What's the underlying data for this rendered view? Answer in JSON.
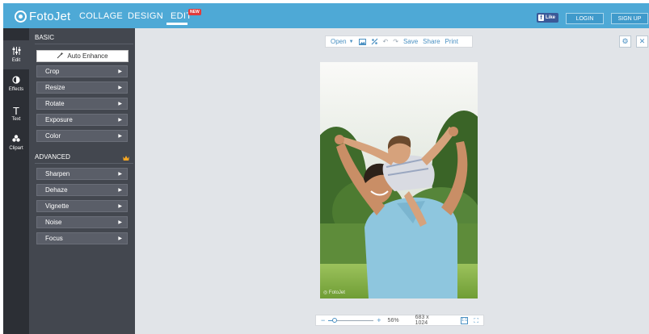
{
  "brand": {
    "name": "FotoJet"
  },
  "nav": {
    "items": [
      {
        "label": "COLLAGE"
      },
      {
        "label": "DESIGN"
      },
      {
        "label": "EDIT"
      }
    ],
    "new_badge": "NEW",
    "active_tab": "EDIT"
  },
  "top_actions": {
    "fb_like": "Like",
    "login": "LOGIN",
    "signup": "SIGN UP"
  },
  "rail": {
    "items": [
      {
        "label": "Edit",
        "icon": "sliders-icon",
        "active": true
      },
      {
        "label": "Effects",
        "icon": "effects-icon",
        "active": false
      },
      {
        "label": "Text",
        "icon": "text-icon",
        "active": false
      },
      {
        "label": "Clipart",
        "icon": "clipart-icon",
        "active": false
      }
    ]
  },
  "panel": {
    "basic_title": "BASIC",
    "auto_enhance": "Auto Enhance",
    "basic_tools": [
      "Crop",
      "Resize",
      "Rotate",
      "Exposure",
      "Color"
    ],
    "advanced_title": "ADVANCED",
    "advanced_tools": [
      "Sharpen",
      "Dehaze",
      "Vignette",
      "Noise",
      "Focus"
    ]
  },
  "toolbar": {
    "open": "Open",
    "save": "Save",
    "share": "Share",
    "print": "Print"
  },
  "zoom": {
    "percent": "56%",
    "level": 0.56,
    "dimensions": "683 x 1024"
  },
  "colors": {
    "topbar": "#4ea9d6",
    "rail": "#2c2f35",
    "panel": "#43474f",
    "canvas": "#e1e4e8",
    "accent": "#4a90c2",
    "new_badge": "#e23b3b",
    "premium_crown": "#f5a623"
  }
}
